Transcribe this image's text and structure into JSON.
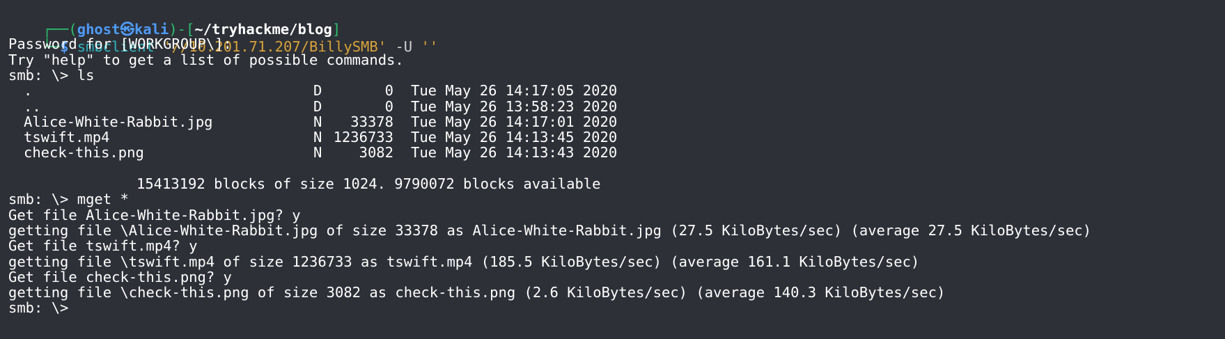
{
  "prompt": {
    "corner_top": "┌──(",
    "user": "ghost",
    "skull_glyph": "㉿",
    "host": "kali",
    "mid": ")-[",
    "path": "~/tryhackme/blog",
    "close": "]",
    "corner_bottom": "└─",
    "dollar": "$ "
  },
  "command": {
    "program": "smbclient",
    "arg_share": "'//10.201.71.207/BillySMB'",
    "flag": "-U",
    "arg_user": "''"
  },
  "output": {
    "password_prompt": "Password for [WORKGROUP\\]:",
    "help_hint": "Try \"help\" to get a list of possible commands.",
    "smb_prompt_1": "smb: \\> ls",
    "listing": [
      {
        "name": ".",
        "attr": "D",
        "size": "0",
        "date": "Tue May 26 14:17:05 2020"
      },
      {
        "name": "..",
        "attr": "D",
        "size": "0",
        "date": "Tue May 26 13:58:23 2020"
      },
      {
        "name": "Alice-White-Rabbit.jpg",
        "attr": "N",
        "size": "33378",
        "date": "Tue May 26 14:17:01 2020"
      },
      {
        "name": "tswift.mp4",
        "attr": "N",
        "size": "1236733",
        "date": "Tue May 26 14:13:45 2020"
      },
      {
        "name": "check-this.png",
        "attr": "N",
        "size": "3082",
        "date": "Tue May 26 14:13:43 2020"
      }
    ],
    "blocks_summary": "15413192 blocks of size 1024. 9790072 blocks available",
    "smb_prompt_2": "smb: \\> mget *",
    "get_1_q": "Get file Alice-White-Rabbit.jpg? y",
    "get_1_r": "getting file \\Alice-White-Rabbit.jpg of size 33378 as Alice-White-Rabbit.jpg (27.5 KiloBytes/sec) (average 27.5 KiloBytes/sec)",
    "get_2_q": "Get file tswift.mp4? y",
    "get_2_r": "getting file \\tswift.mp4 of size 1236733 as tswift.mp4 (185.5 KiloBytes/sec) (average 161.1 KiloBytes/sec)",
    "get_3_q": "Get file check-this.png? y",
    "get_3_r": "getting file \\check-this.png of size 3082 as check-this.png (2.6 KiloBytes/sec) (average 140.3 KiloBytes/sec)",
    "partial_last": "smb: \\> "
  },
  "colors": {
    "background": "#2d3037",
    "prompt_frame": "#2dbf6f",
    "user_host": "#4f9bf7",
    "command": "#2fb7c2",
    "string_arg": "#d9a33a",
    "text": "#ffffff"
  }
}
